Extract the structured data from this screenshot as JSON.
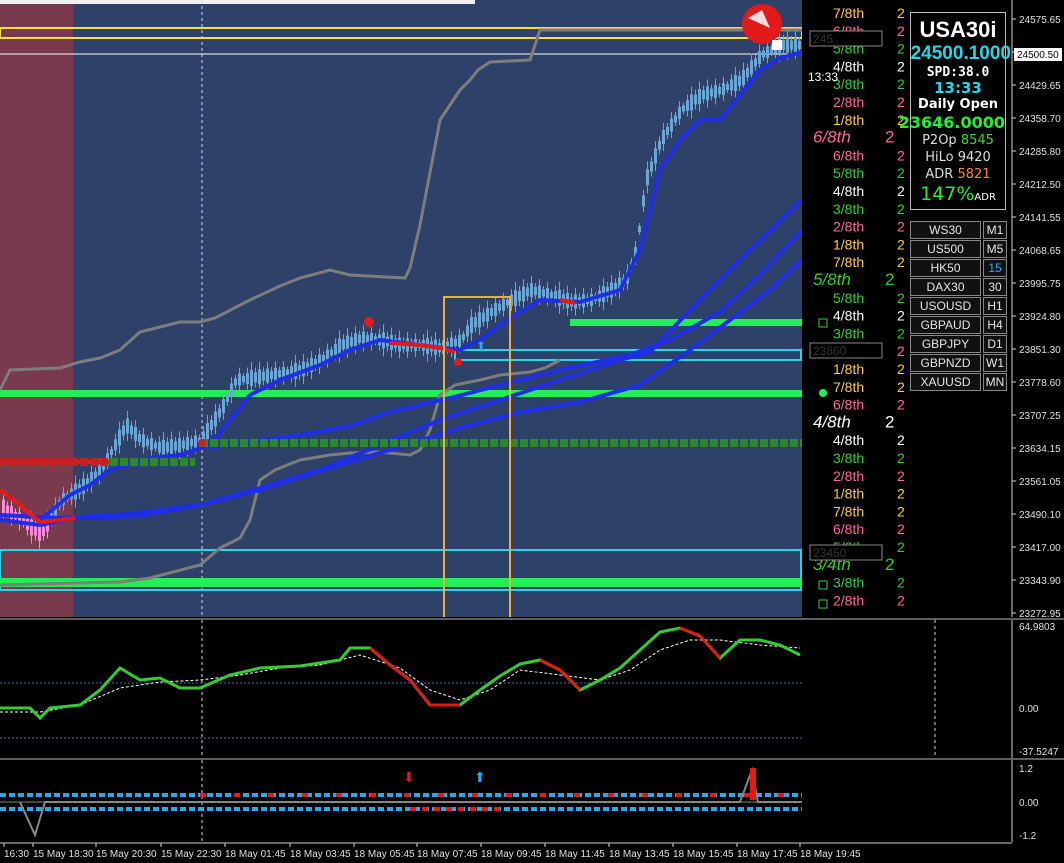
{
  "symbol": "USA30i",
  "price": "24500.1000",
  "spread": "SPD:38.0",
  "time": "13:33",
  "daily_open_label": "Daily Open",
  "daily_open": "23646.0000",
  "stats": [
    {
      "label": "P2Op",
      "value": "8545",
      "color": "#33dd33"
    },
    {
      "label": "HiLo",
      "value": "9420",
      "color": "#dddddd"
    },
    {
      "label": "ADR",
      "value": "5821",
      "color": "#ff8c1a"
    }
  ],
  "adr_pct": "147%",
  "adr_pct_label": "ADR",
  "symbols": [
    "WS30",
    "US500",
    "HK50",
    "DAX30",
    "USOUSD",
    "GBPAUD",
    "GBPJPY",
    "GBPNZD",
    "XAUUSD"
  ],
  "timeframes": [
    "M1",
    "M5",
    "15",
    "30",
    "H1",
    "H4",
    "D1",
    "W1",
    "MN"
  ],
  "price_axis": [
    "24575.65",
    "24500.50",
    "24429.65",
    "24358.70",
    "24285.80",
    "24212.50",
    "24141.55",
    "24068.65",
    "23995.75",
    "23924.80",
    "23851.30",
    "23778.60",
    "23707.25",
    "23634.15",
    "23561.05",
    "23490.10",
    "23417.00",
    "23343.90",
    "23272.95"
  ],
  "current_price_label": "24500.50",
  "osc_axis": [
    "64.9803",
    "0.00",
    "-37.5247"
  ],
  "sig_axis": [
    "1.2",
    "0.00",
    "-1.2"
  ],
  "time_axis": [
    "16:30",
    "15 May 18:30",
    "15 May 20:30",
    "15 May 22:30",
    "18 May 01:45",
    "18 May 03:45",
    "18 May 05:45",
    "18 May 07:45",
    "18 May 09:45",
    "18 May 11:45",
    "18 May 13:45",
    "18 May 15:45",
    "18 May 17:45",
    "18 May 19:45"
  ],
  "murrey_levels": [
    {
      "text": "7/8th",
      "color": "#ffcc33"
    },
    {
      "text": "6/8th",
      "color": "#ff6699"
    },
    {
      "text": "5/8th",
      "color": "#33cc33"
    },
    {
      "text": "4/8th",
      "color": "#ffffff"
    },
    {
      "text": "3/8th",
      "color": "#33cc33"
    },
    {
      "text": "2/8th",
      "color": "#ff6699"
    },
    {
      "text": "1/8th",
      "color": "#ffcc33"
    }
  ],
  "murrey_big": [
    {
      "text": "6/8th",
      "color": "#ff6699",
      "suffix": "2"
    },
    {
      "text": "5/8th",
      "color": "#33cc33",
      "suffix": "2"
    },
    {
      "text": "4/8th",
      "color": "#ffffff",
      "suffix": "2"
    },
    {
      "text": "3/4th",
      "color": "#33cc33",
      "suffix": "2"
    }
  ],
  "murrey_suffix": "2",
  "price_tags": [
    "245",
    "23860",
    "23450"
  ],
  "candle_time_label": "13:33",
  "colors": {
    "background": "#000000",
    "chart_bg": "#2e4168",
    "session_bg": "#7a3a4e",
    "candle": "#6aa7d6",
    "ma_blue": "#1e2ee8",
    "ma_red": "#e21a1a",
    "ma_gray": "#7d7d7d",
    "level_green": "#22ee55",
    "box_cyan": "#22d8e8",
    "highlight_box": "#f0b133",
    "yellow_box": "#f0e040"
  }
}
